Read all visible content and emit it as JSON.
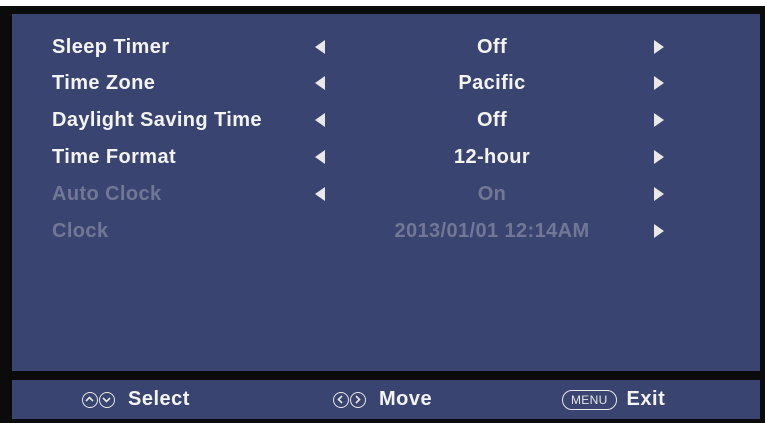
{
  "menu": {
    "rows": [
      {
        "label": "Sleep Timer",
        "value": "Off",
        "enabled": true
      },
      {
        "label": "Time Zone",
        "value": "Pacific",
        "enabled": true
      },
      {
        "label": "Daylight Saving Time",
        "value": "Off",
        "enabled": true
      },
      {
        "label": "Time Format",
        "value": "12-hour",
        "enabled": true
      },
      {
        "label": "Auto Clock",
        "value": "On",
        "enabled": false
      },
      {
        "label": "Clock",
        "value": "2013/01/01 12:14AM",
        "enabled": false
      }
    ]
  },
  "footer": {
    "select_label": "Select",
    "move_label": "Move",
    "menu_key": "MENU",
    "exit_label": "Exit"
  },
  "colors": {
    "panel_background": "#3a4470",
    "text": "#f4f4f4",
    "disabled_text": "#717896",
    "frame": "#0b0b0b"
  },
  "icons": {
    "left_arrow": "chevron-left-icon",
    "right_arrow": "chevron-right-icon",
    "up_button": "up-button-icon",
    "down_button": "down-button-icon"
  }
}
